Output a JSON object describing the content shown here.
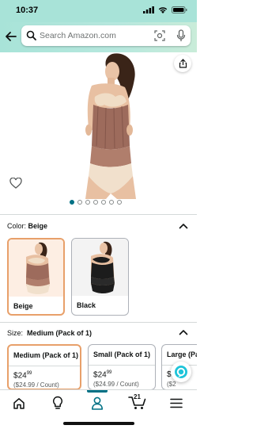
{
  "status_bar": {
    "time": "10:37"
  },
  "search": {
    "placeholder": "Search Amazon.com"
  },
  "gallery": {
    "image_count": 7,
    "active_index": 0
  },
  "color": {
    "label": "Color:",
    "selected": "Beige",
    "options": [
      {
        "label": "Beige",
        "selected": true
      },
      {
        "label": "Black",
        "selected": false
      }
    ]
  },
  "size": {
    "label": "Size:",
    "selected": "Medium (Pack of 1)",
    "options": [
      {
        "title": "Medium (Pack of 1)",
        "price_dollars": "24",
        "price_cents": "99",
        "unit_price": "($24.99 / Count)",
        "selected": true
      },
      {
        "title": "Small (Pack of 1)",
        "price_dollars": "24",
        "price_cents": "99",
        "unit_price": "($24.99 / Count)",
        "selected": false
      },
      {
        "title": "Large (Pa",
        "price_dollars": "2",
        "price_cents": "",
        "unit_price": "($2",
        "selected": false
      }
    ]
  },
  "tab_bar": {
    "cart_count": "21",
    "tabs": [
      "home-icon",
      "lightbulb-icon",
      "account-icon",
      "cart-icon",
      "menu-icon"
    ],
    "active_tab": "account-icon"
  },
  "colors": {
    "accent": "#007185",
    "selected_border": "#e8a06a",
    "header_bg": "#a8e3d8"
  }
}
